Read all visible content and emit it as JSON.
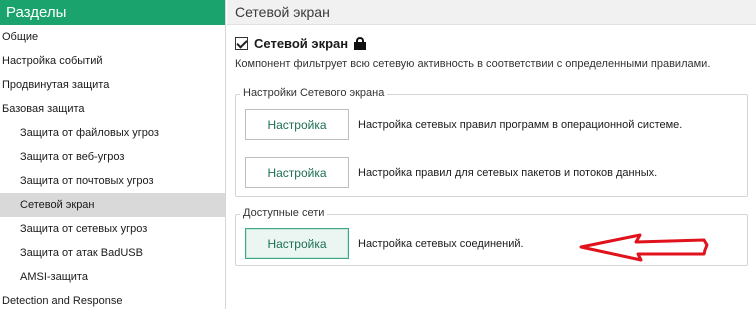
{
  "sidebar": {
    "title": "Разделы",
    "items": [
      {
        "label": "Общие"
      },
      {
        "label": "Настройка событий"
      },
      {
        "label": "Продвинутая защита"
      },
      {
        "label": "Базовая защита"
      },
      {
        "label": "Защита от файловых угроз"
      },
      {
        "label": "Защита от веб-угроз"
      },
      {
        "label": "Защита от почтовых угроз"
      },
      {
        "label": "Сетевой экран"
      },
      {
        "label": "Защита от сетевых угроз"
      },
      {
        "label": "Защита от атак BadUSB"
      },
      {
        "label": "AMSI-защита"
      },
      {
        "label": "Detection and Response"
      }
    ],
    "selected": "Сетевой экран"
  },
  "main": {
    "title": "Сетевой экран",
    "component": {
      "label": "Сетевой экран",
      "enabled": true,
      "lock_icon": "lock-icon",
      "description": "Компонент фильтрует всю сетевую активность в соответствии с определенными правилами."
    },
    "firewall_settings": {
      "legend": "Настройки Сетевого экрана",
      "rows": [
        {
          "button": "Настройка",
          "text": "Настройка сетевых правил программ в операционной системе."
        },
        {
          "button": "Настройка",
          "text": "Настройка правил для сетевых пакетов и потоков данных."
        }
      ]
    },
    "available_networks": {
      "legend": "Доступные сети",
      "rows": [
        {
          "button": "Настройка",
          "text": "Настройка сетевых соединений."
        }
      ]
    }
  },
  "colors": {
    "accent": "#1aa36d",
    "button_text": "#1c6f55",
    "selected_bg": "#d9d9d9",
    "annotation_arrow": "#e0121b"
  }
}
